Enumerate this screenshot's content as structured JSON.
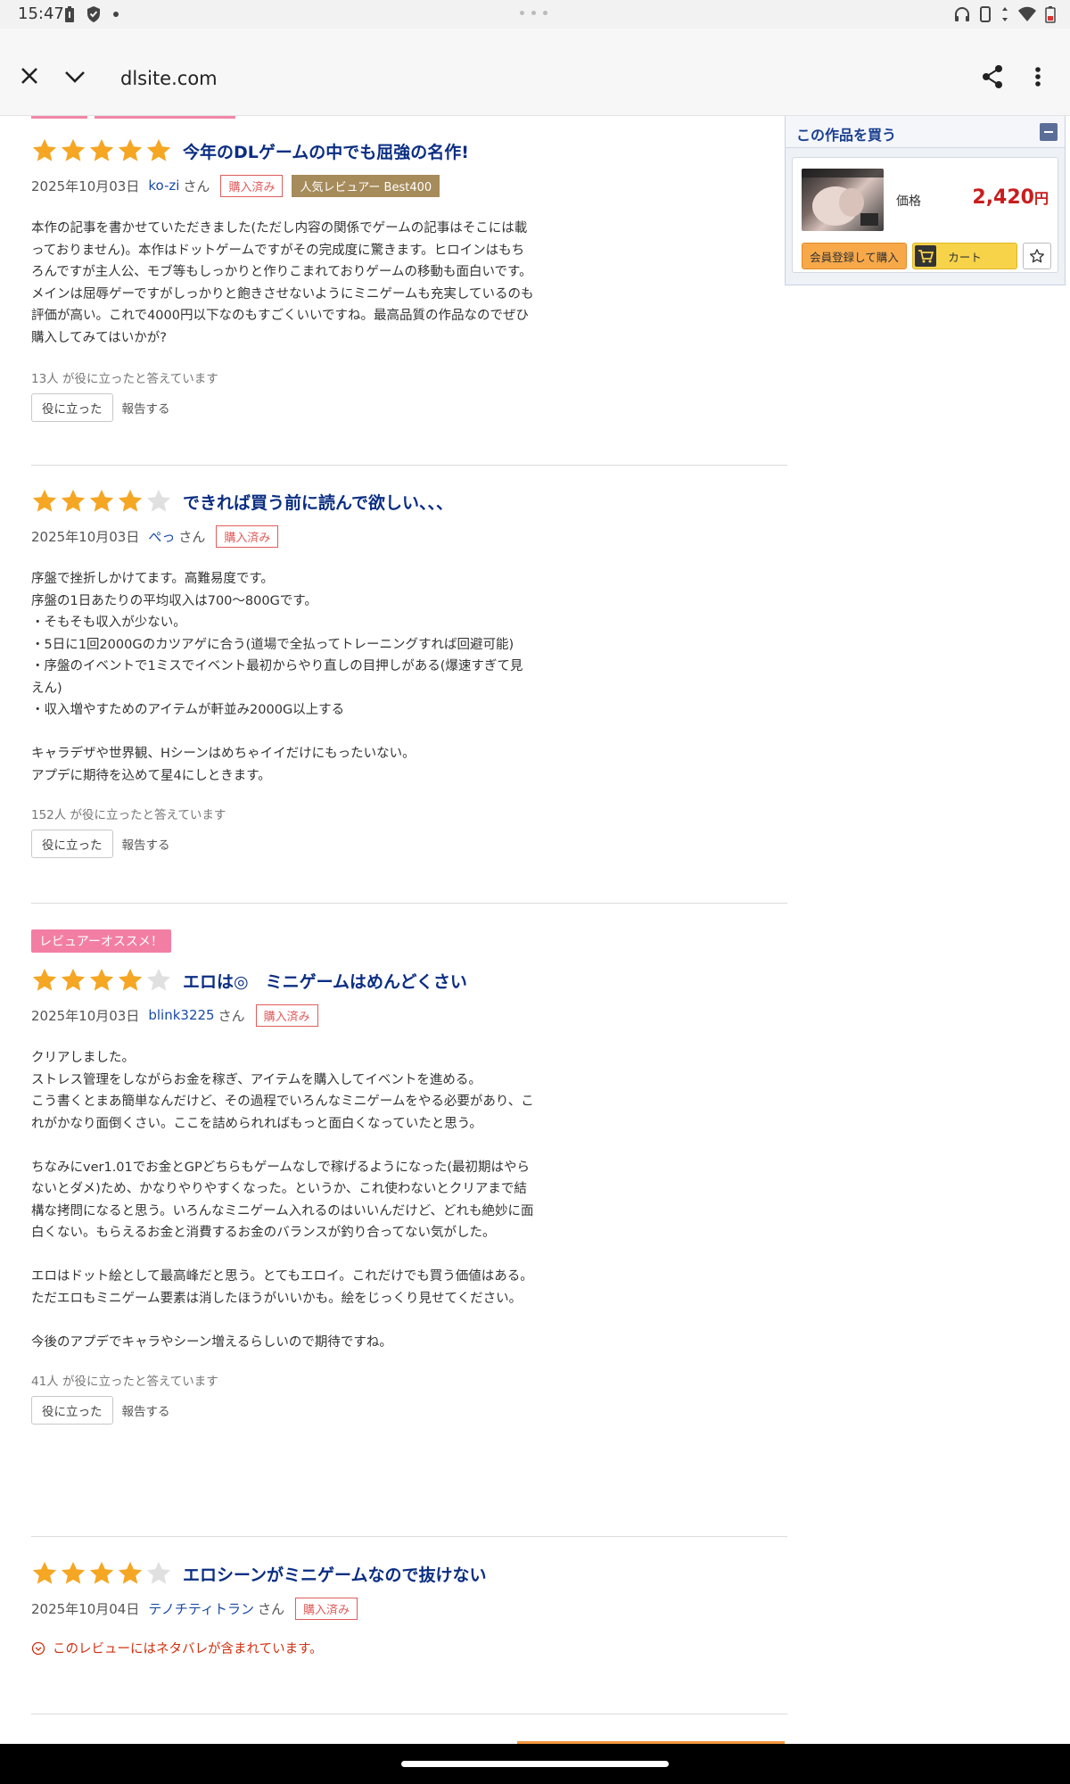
{
  "status_bar": {
    "time": "15:47"
  },
  "browser": {
    "url": "dlsite.com"
  },
  "colors": {
    "star_filled": "#f5a623",
    "star_empty": "#e0e0e0",
    "title_blue": "#0b2e83",
    "price_red": "#c91d1d",
    "purchased_red": "#e05c5c",
    "reviewer_gold": "#a68b5b",
    "recommend_pink": "#f37ea4"
  },
  "buy_box": {
    "title": "この作品を買う",
    "price_label": "価格",
    "price": "2,420",
    "price_unit": "円",
    "register_button": "会員登録して購入",
    "cart_button": "カート",
    "thumbnail_alt_text": "ゲーム作品サムネイル"
  },
  "reviews": [
    {
      "stars": 5,
      "title": "今年のDLゲームの中でも屈強の名作!",
      "date": "2025年10月03日",
      "user": "ko-zi",
      "san": "さん",
      "purchased": "購入済み",
      "reviewer_badge": "人気レビュアー Best400",
      "body": "本作の記事を書かせていただきました(ただし内容の関係でゲームの記事はそこには載っておりません)。本作はドットゲームですがその完成度に驚きます。ヒロインはもちろんですが主人公、モブ等もしっかりと作りこまれておりゲームの移動も面白いです。メインは屈辱ゲーですがしっかりと飽きさせないようにミニゲームも充実しているのも評価が高い。これで4000円以下なのもすごくいいですね。最高品質の作品なのでぜひ購入してみてはいかが?",
      "helpful_count": "13人 が役に立ったと答えています",
      "helpful_button": "役に立った",
      "report": "報告する"
    },
    {
      "stars": 4,
      "title": "できれば買う前に読んで欲しい、、、",
      "date": "2025年10月03日",
      "user": "ぺっ",
      "san": "さん",
      "purchased": "購入済み",
      "body": "序盤で挫折しかけてます。高難易度です。\n序盤の1日あたりの平均収入は700～800Gです。\n・そもそも収入が少ない。\n・5日に1回2000Gのカツアゲに合う(道場で全払ってトレーニングすれば回避可能)\n・序盤のイベントで1ミスでイベント最初からやり直しの目押しがある(爆速すぎて見えん)\n・収入増やすためのアイテムが軒並み2000G以上する\n\nキャラデザや世界観、Hシーンはめちゃイイだけにもったいない。\nアプデに期待を込めて星4にしときます。",
      "helpful_count": "152人 が役に立ったと答えています",
      "helpful_button": "役に立った",
      "report": "報告する"
    },
    {
      "recommend_badge": "レビュアーオススメ！",
      "stars": 4,
      "title": "エロは◎　ミニゲームはめんどくさい",
      "date": "2025年10月03日",
      "user": "blink3225",
      "san": "さん",
      "purchased": "購入済み",
      "body": "クリアしました。\nストレス管理をしながらお金を稼ぎ、アイテムを購入してイベントを進める。\nこう書くとまあ簡単なんだけど、その過程でいろんなミニゲームをやる必要があり、これがかなり面倒くさい。ここを詰められればもっと面白くなっていたと思う。\n\nちなみにver1.01でお金とGPどちらもゲームなしで稼げるようになった(最初期はやらないとダメ)ため、かなりやりやすくなった。というか、これ使わないとクリアまで結構な拷問になると思う。いろんなミニゲーム入れるのはいいんだけど、どれも絶妙に面白くない。もらえるお金と消費するお金のバランスが釣り合ってない気がした。\n\nエロはドット絵として最高峰だと思う。とてもエロイ。これだけでも買う価値はある。ただエロもミニゲーム要素は消したほうがいいかも。絵をじっくり見せてください。\n\n今後のアプデでキャラやシーン増えるらしいので期待ですね。",
      "helpful_count": "41人 が役に立ったと答えています",
      "helpful_button": "役に立った",
      "report": "報告する"
    },
    {
      "stars": 4,
      "title": "エロシーンがミニゲームなので抜けない",
      "date": "2025年10月04日",
      "user": "テノチティトラン",
      "san": "さん",
      "purchased": "購入済み",
      "spoiler": "このレビューにはネタバレが含まれています。"
    }
  ]
}
